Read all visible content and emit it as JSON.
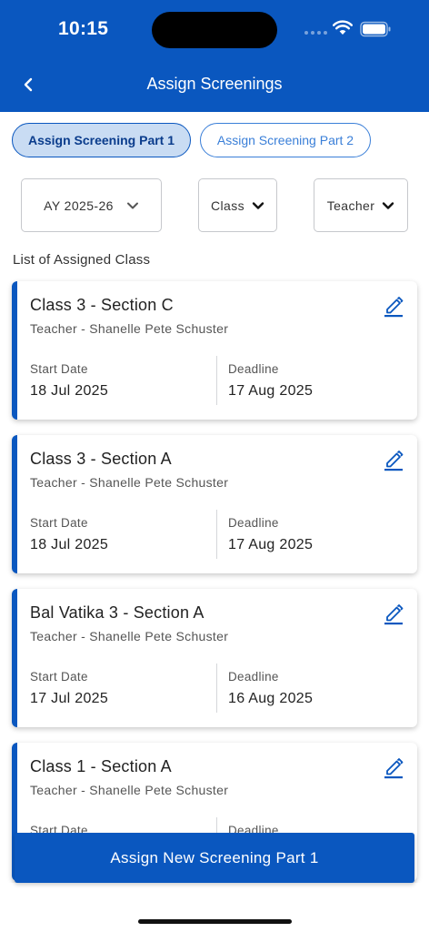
{
  "status_bar": {
    "time": "10:15"
  },
  "header": {
    "title": "Assign Screenings"
  },
  "tabs": [
    {
      "label": "Assign Screening Part 1",
      "active": true
    },
    {
      "label": "Assign Screening Part 2",
      "active": false
    }
  ],
  "filters": {
    "academic_year": "AY 2025-26",
    "class": "Class",
    "teacher": "Teacher"
  },
  "list_heading": "List of Assigned Class",
  "cards": [
    {
      "title": "Class 3 - Section C",
      "teacher": "Teacher - Shanelle Pete Schuster",
      "start_label": "Start Date",
      "start_date": "18 Jul 2025",
      "deadline_label": "Deadline",
      "deadline": "17 Aug 2025"
    },
    {
      "title": "Class 3 - Section A",
      "teacher": "Teacher - Shanelle Pete Schuster",
      "start_label": "Start Date",
      "start_date": "18 Jul 2025",
      "deadline_label": "Deadline",
      "deadline": "17 Aug 2025"
    },
    {
      "title": "Bal Vatika 3 - Section A",
      "teacher": "Teacher - Shanelle Pete Schuster",
      "start_label": "Start Date",
      "start_date": "17 Jul 2025",
      "deadline_label": "Deadline",
      "deadline": "16 Aug 2025"
    },
    {
      "title": "Class 1 - Section A",
      "teacher": "Teacher - Shanelle Pete Schuster",
      "start_label": "Start Date",
      "start_date": "",
      "deadline_label": "Deadline",
      "deadline": ""
    }
  ],
  "cta_label": "Assign New Screening Part 1",
  "colors": {
    "primary": "#0a57bf",
    "tab_active_bg": "#c9dcf3",
    "tab_inactive_text": "#3a7fd8"
  },
  "icons": {
    "back": "chevron-left-icon",
    "dropdown": "chevron-down-icon",
    "edit": "pencil-icon"
  }
}
